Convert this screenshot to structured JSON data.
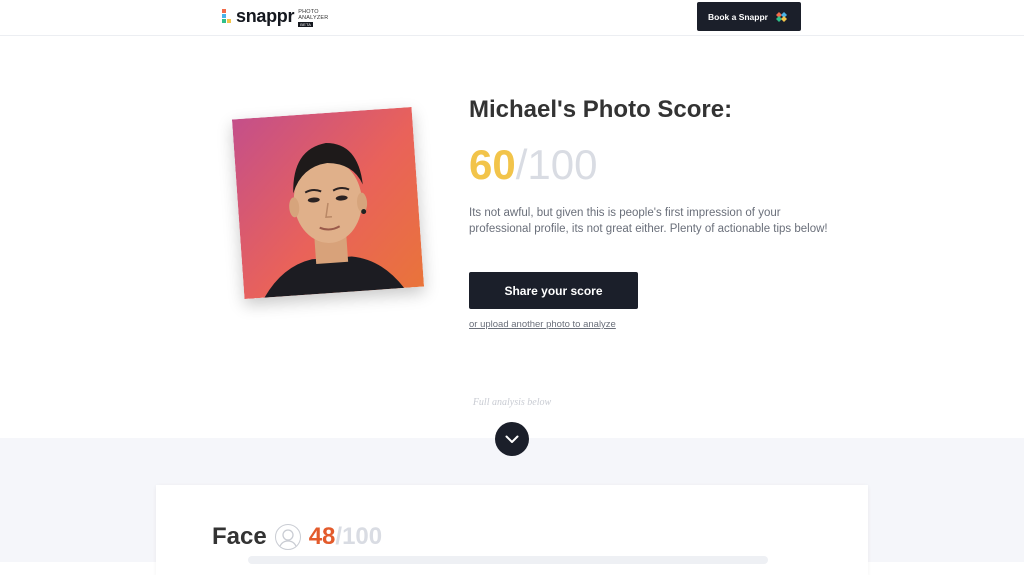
{
  "header": {
    "brand": "snappr",
    "subtitle_line1": "PHOTO",
    "subtitle_line2": "ANALYZER",
    "badge": "BETA",
    "book_button": "Book a Snappr"
  },
  "result": {
    "title": "Michael's Photo Score:",
    "score": "60",
    "score_max": "/100",
    "description": "Its not awful, but given this is people's first impression of your professional profile, its not great either. Plenty of actionable tips below!",
    "share_button": "Share your score",
    "upload_link": "or upload another photo to analyze",
    "analysis_hint": "Full analysis below"
  },
  "face_section": {
    "label": "Face",
    "score": "48",
    "score_max": "/100"
  },
  "colors": {
    "accent_yellow": "#f2c44a",
    "accent_orange": "#e35b2c",
    "dark": "#1b1f2a"
  }
}
